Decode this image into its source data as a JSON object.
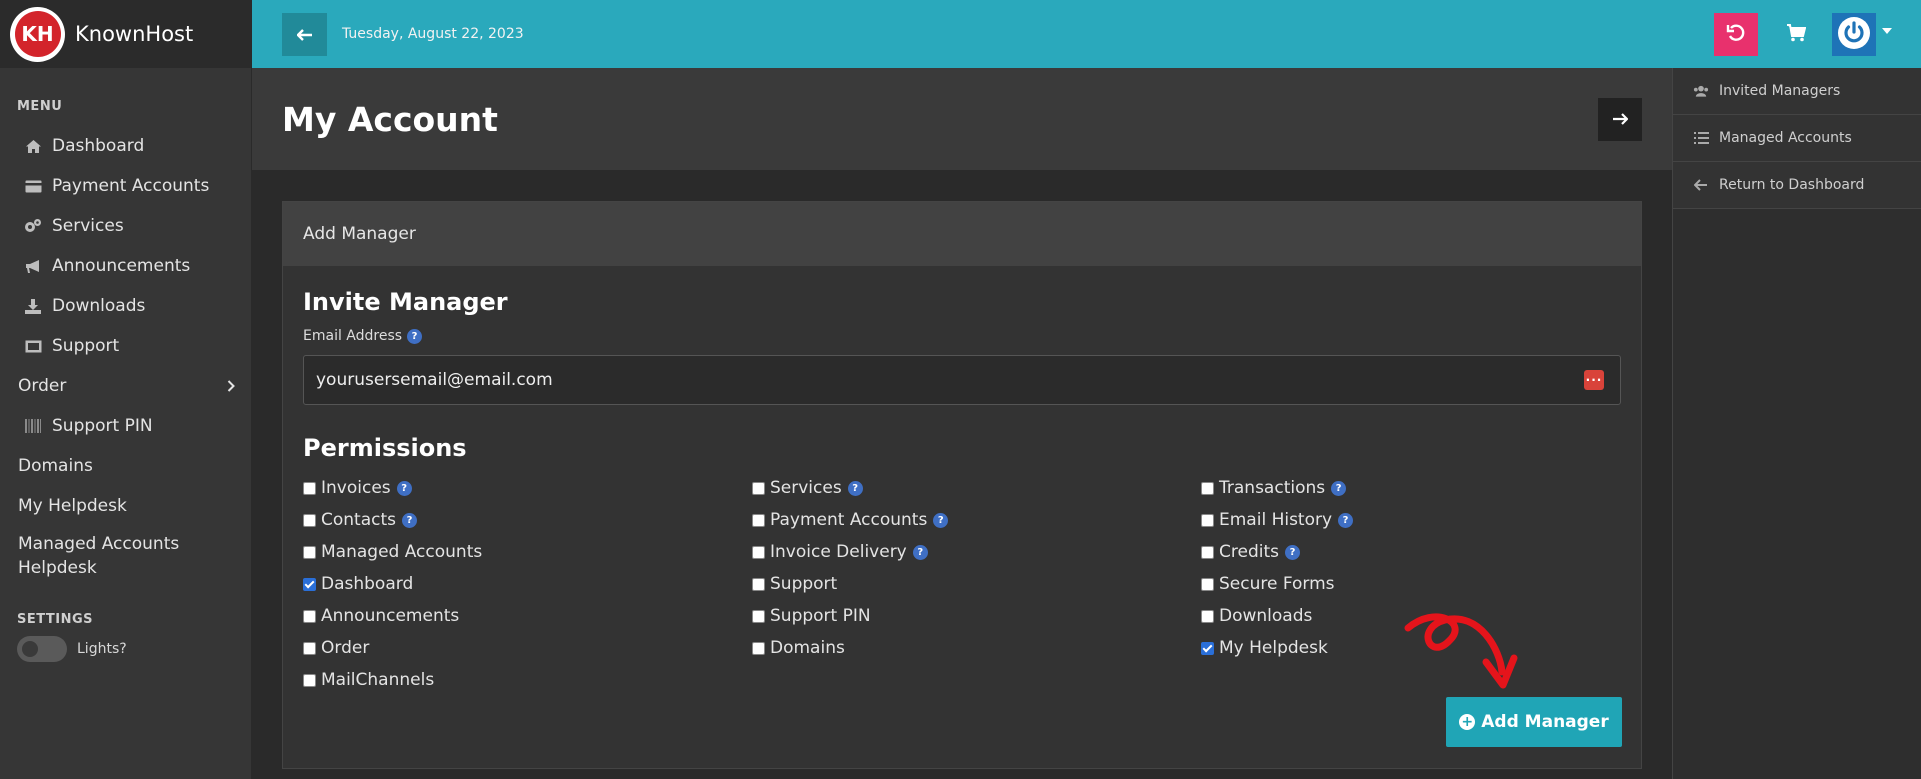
{
  "brand": {
    "name": "KnownHost",
    "logo_text": "KH"
  },
  "sidebar": {
    "menu_heading": "MENU",
    "items": [
      {
        "label": "Dashboard",
        "icon": "home-icon"
      },
      {
        "label": "Payment Accounts",
        "icon": "credit-card-icon"
      },
      {
        "label": "Services",
        "icon": "gears-icon"
      },
      {
        "label": "Announcements",
        "icon": "bullhorn-icon"
      },
      {
        "label": "Downloads",
        "icon": "download-icon"
      },
      {
        "label": "Support",
        "icon": "ticket-icon"
      },
      {
        "label": "Order",
        "icon": "chevron-right-icon"
      },
      {
        "label": "Support PIN",
        "icon": "barcode-icon"
      },
      {
        "label": "Domains"
      },
      {
        "label": "My Helpdesk"
      },
      {
        "label": "Managed Accounts Helpdesk"
      }
    ],
    "settings_heading": "SETTINGS",
    "lights_label": "Lights?"
  },
  "topbar": {
    "date": "Tuesday, August 22, 2023",
    "icons": [
      "back-arrow-icon",
      "undo-icon",
      "cart-icon",
      "power-icon"
    ]
  },
  "page": {
    "title": "My Account"
  },
  "right_panel": {
    "items": [
      {
        "label": "Invited Managers",
        "icon": "users-icon"
      },
      {
        "label": "Managed Accounts",
        "icon": "list-icon"
      },
      {
        "label": "Return to Dashboard",
        "icon": "arrow-left-icon"
      }
    ]
  },
  "card": {
    "header": "Add Manager",
    "invite_title": "Invite Manager",
    "email_label": "Email Address",
    "email_value": "yourusersemail@email.com",
    "permissions_title": "Permissions",
    "permissions": {
      "col1": [
        {
          "label": "Invoices",
          "checked": false,
          "help": true
        },
        {
          "label": "Contacts",
          "checked": false,
          "help": true
        },
        {
          "label": "Managed Accounts",
          "checked": false,
          "help": false
        },
        {
          "label": "Dashboard",
          "checked": true,
          "help": false
        },
        {
          "label": "Announcements",
          "checked": false,
          "help": false
        },
        {
          "label": "Order",
          "checked": false,
          "help": false
        },
        {
          "label": "MailChannels",
          "checked": false,
          "help": false
        }
      ],
      "col2": [
        {
          "label": "Services",
          "checked": false,
          "help": true
        },
        {
          "label": "Payment Accounts",
          "checked": false,
          "help": true
        },
        {
          "label": "Invoice Delivery",
          "checked": false,
          "help": true
        },
        {
          "label": "Support",
          "checked": false,
          "help": false
        },
        {
          "label": "Support PIN",
          "checked": false,
          "help": false
        },
        {
          "label": "Domains",
          "checked": false,
          "help": false
        }
      ],
      "col3": [
        {
          "label": "Transactions",
          "checked": false,
          "help": true
        },
        {
          "label": "Email History",
          "checked": false,
          "help": true
        },
        {
          "label": "Credits",
          "checked": false,
          "help": true
        },
        {
          "label": "Secure Forms",
          "checked": false,
          "help": false
        },
        {
          "label": "Downloads",
          "checked": false,
          "help": false
        },
        {
          "label": "My Helpdesk",
          "checked": true,
          "help": false
        }
      ]
    },
    "add_button_label": "Add Manager"
  },
  "colors": {
    "accent": "#2aa9bc",
    "undo": "#e8316d",
    "user": "#1e73b7",
    "annotation_arrow": "#e5141b"
  }
}
